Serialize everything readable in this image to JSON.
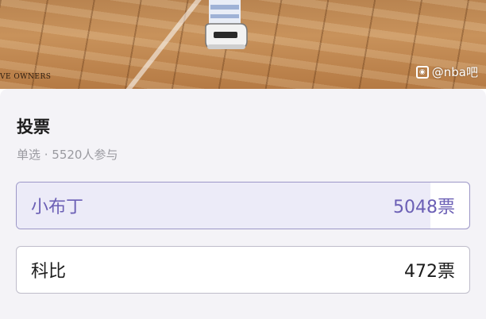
{
  "hero": {
    "caption": "VE OWNERS",
    "watermark": "@nba吧",
    "watermark_icon": "camera-icon"
  },
  "poll": {
    "title": "投票",
    "meta": "单选 · 5520人参与",
    "accent_color": "#6b5fb5",
    "options": [
      {
        "label": "小布丁",
        "count": "5048票",
        "votes": 5048,
        "selected": true
      },
      {
        "label": "科比",
        "count": "472票",
        "votes": 472,
        "selected": false
      }
    ]
  }
}
